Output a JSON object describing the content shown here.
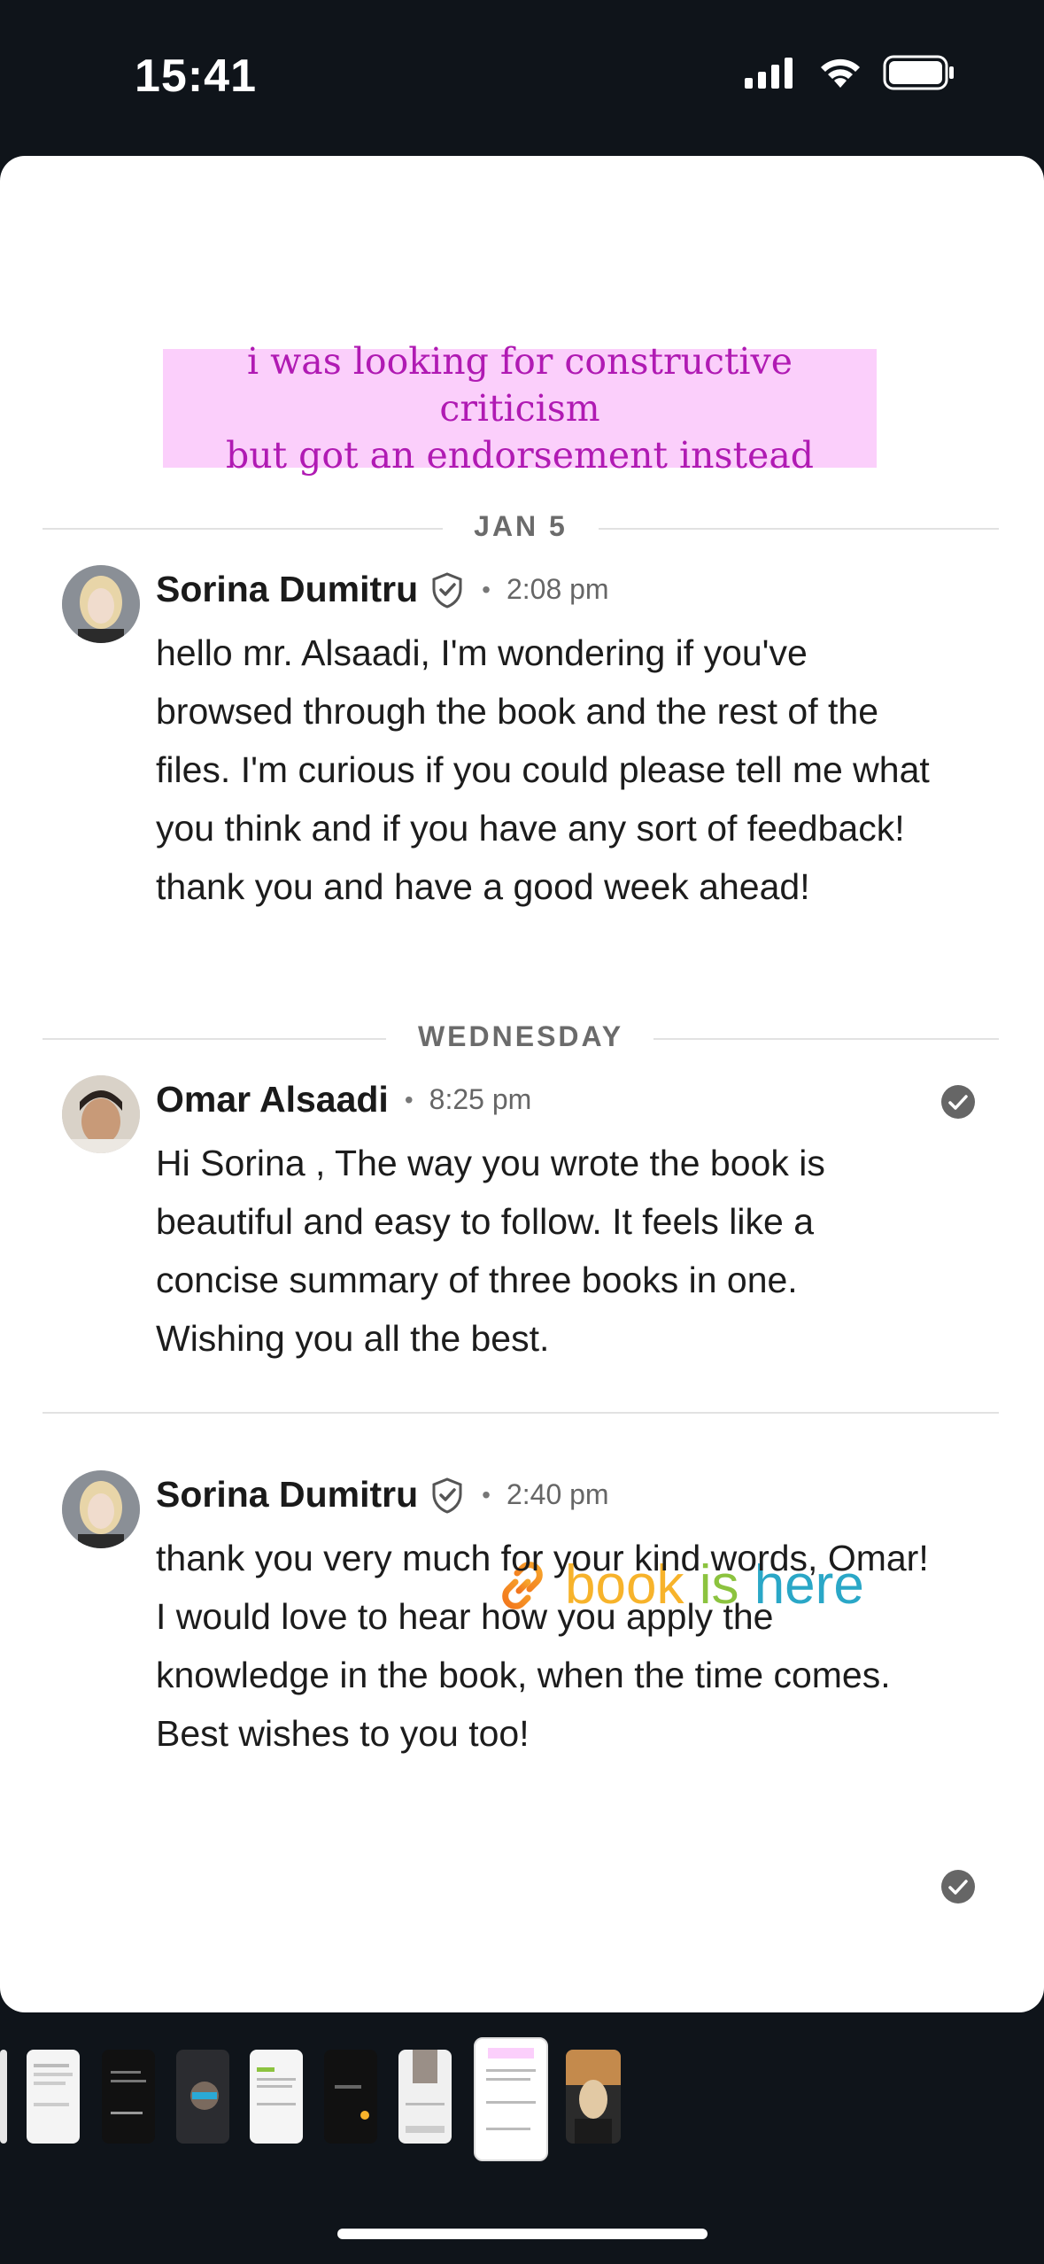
{
  "status_bar": {
    "time": "15:41"
  },
  "caption": {
    "line1": "i was looking for constructive criticism",
    "line2": "but got an endorsement instead"
  },
  "dates": {
    "first": "JAN 5",
    "second": "WEDNESDAY"
  },
  "messages": [
    {
      "sender": "Sorina Dumitru",
      "time": "2:08 pm",
      "text": "hello mr. Alsaadi, I'm wondering if you've browsed through the book and the rest of the files. I'm curious if you could please tell me what you think and if you have any sort of feedback! thank you and have a good week ahead!"
    },
    {
      "sender": "Omar Alsaadi",
      "time": "8:25 pm",
      "text": "Hi Sorina , The way you wrote the book is beautiful and easy to follow. It feels like a concise summary of three books in one. Wishing you all the best."
    },
    {
      "sender": "Sorina Dumitru",
      "time": "2:40 pm",
      "text": "thank you very much for your kind words, Omar! I would love to hear how you apply the knowledge in the book, when the time comes. Best wishes to you too!"
    }
  ],
  "link_sticker": {
    "words": [
      "book",
      "is",
      "here"
    ],
    "icon": "link-icon",
    "colors": [
      "#f2761d",
      "#f7b32b",
      "#8cc33f",
      "#2fb38a",
      "#2aa7c7",
      "#3d7fd6"
    ]
  }
}
